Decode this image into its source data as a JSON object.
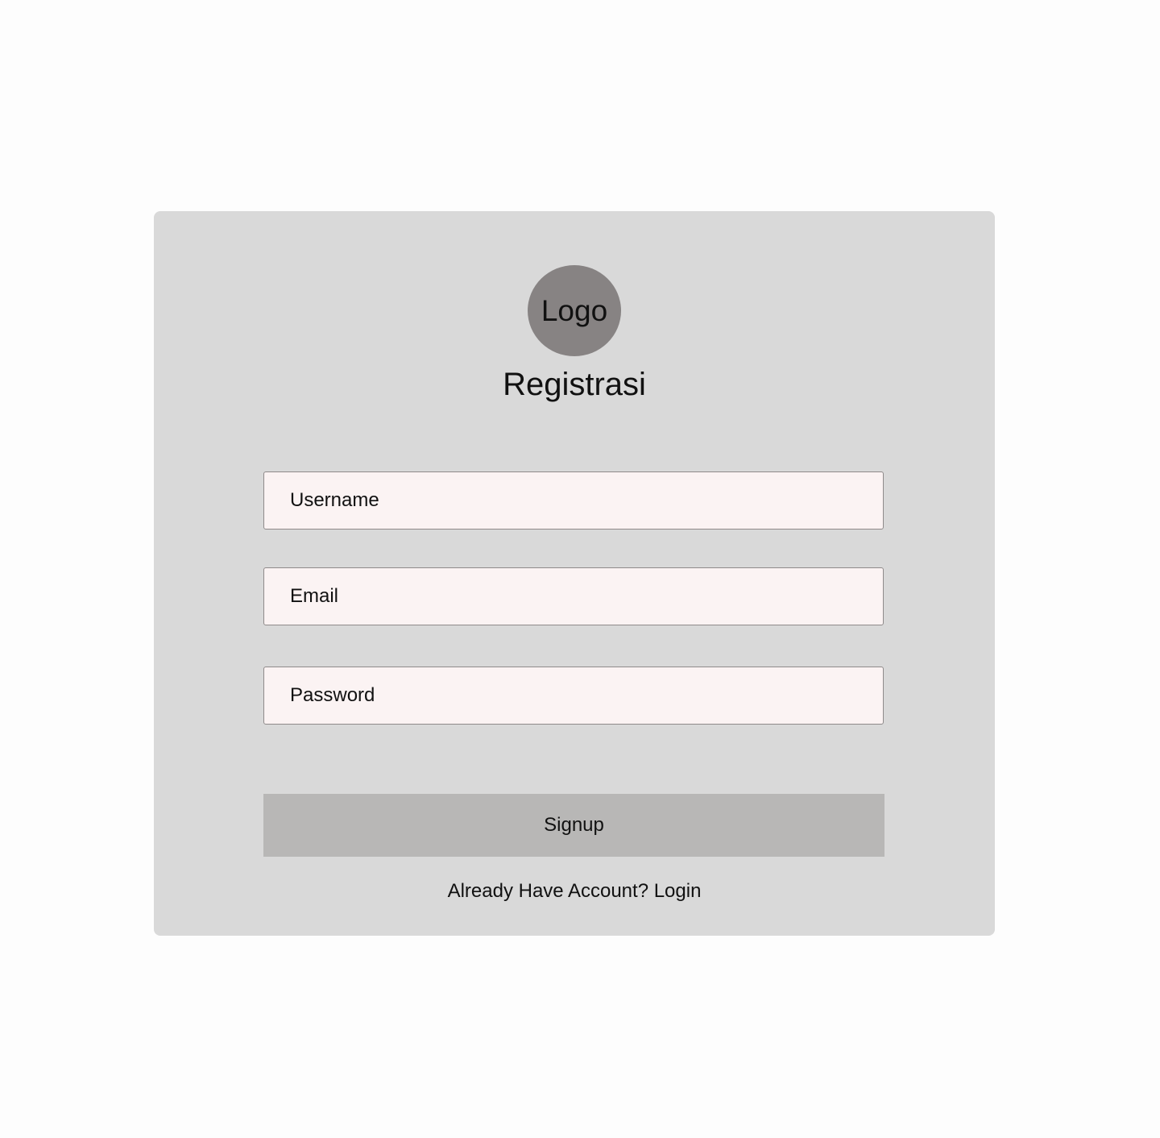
{
  "logo": {
    "text": "Logo"
  },
  "form": {
    "title": "Registrasi",
    "username_placeholder": "Username",
    "email_placeholder": "Email",
    "password_placeholder": "Password",
    "signup_label": "Signup",
    "login_link": "Already Have Account? Login"
  },
  "colors": {
    "page_background": "#fdfdfd",
    "card_background": "#d9d9d9",
    "logo_background": "#878383",
    "input_background": "#fbf3f3",
    "button_background": "#b8b7b6"
  }
}
